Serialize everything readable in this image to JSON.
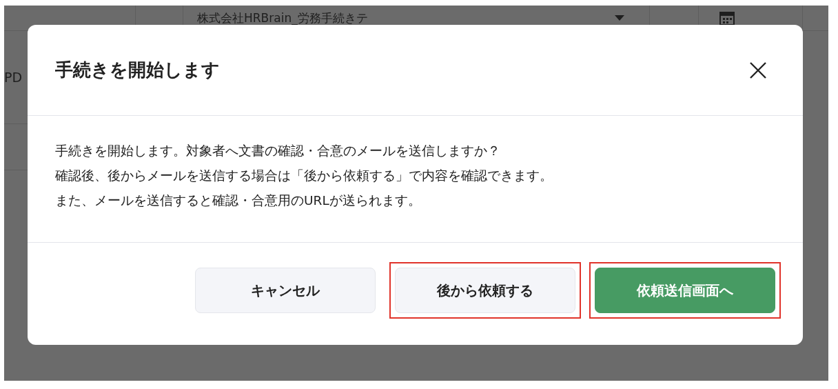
{
  "background": {
    "select_value": "株式会社HRBrain_労務手続きテ",
    "side_text": "PD"
  },
  "dialog": {
    "title": "手続きを開始します",
    "message_lines": [
      "手続きを開始します。対象者へ文書の確認・合意のメールを送信しますか？",
      "確認後、後からメールを送信する場合は「後から依頼する」で内容を確認できます。",
      "また、メールを送信すると確認・合意用のURLが送られます。"
    ],
    "buttons": [
      {
        "label": "キャンセル",
        "kind": "secondary",
        "highlighted": false
      },
      {
        "label": "後から依頼する",
        "kind": "secondary",
        "highlighted": true
      },
      {
        "label": "依頼送信画面へ",
        "kind": "primary",
        "highlighted": true
      }
    ]
  }
}
